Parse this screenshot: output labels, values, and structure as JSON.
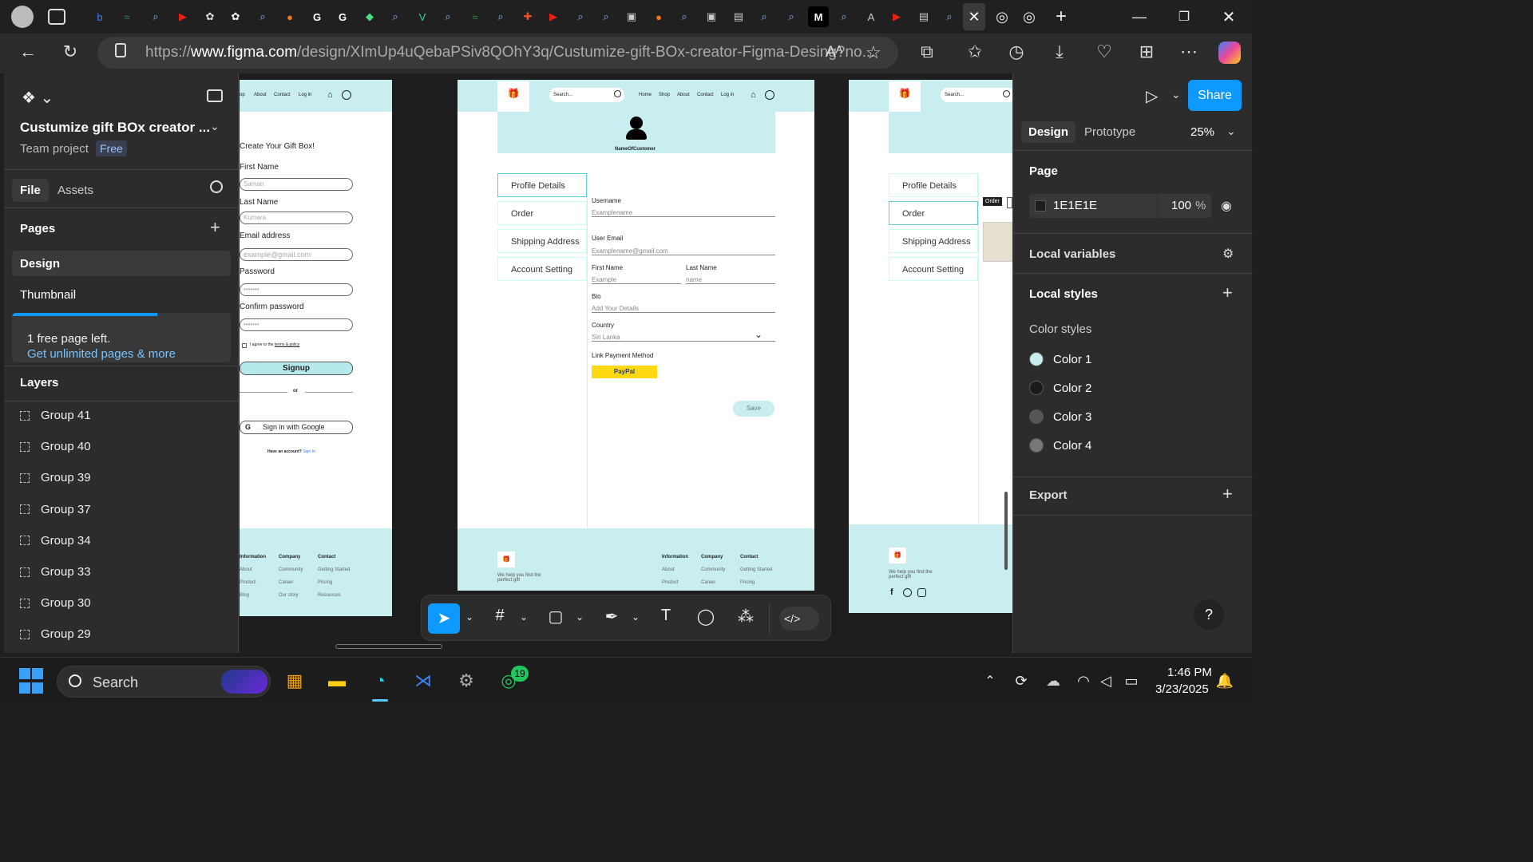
{
  "browser": {
    "url_prefix": "https://",
    "url_domain": "www.figma.com",
    "url_path": "/design/XImUp4uQebaPSiv8QOhY3q/Custumize-gift-BOx-creator-Figma-Desing?no...",
    "read_aloud": "Aᴬ"
  },
  "figma": {
    "file_title": "Custumize gift BOx creator ...",
    "project": "Team project",
    "plan_badge": "Free",
    "tabs": [
      "File",
      "Assets"
    ],
    "pages_header": "Pages",
    "pages": [
      "Design",
      "Thumbnail"
    ],
    "free_notice": "1 free page left.",
    "upgrade_link": "Get unlimited pages & more",
    "layers_header": "Layers",
    "layers": [
      "Group 41",
      "Group 40",
      "Group 39",
      "Group 37",
      "Group 34",
      "Group 33",
      "Group 30",
      "Group 29"
    ],
    "share": "Share",
    "right_tabs": [
      "Design",
      "Prototype"
    ],
    "zoom": "25%",
    "page_section": "Page",
    "page_color": "1E1E1E",
    "page_opacity": "100",
    "percent": "%",
    "local_variables": "Local variables",
    "local_styles": "Local styles",
    "color_styles": "Color styles",
    "colors": [
      {
        "name": "Color 1",
        "hex": "#c8eef0"
      },
      {
        "name": "Color 2",
        "hex": "#1a1a1a"
      },
      {
        "name": "Color 3",
        "hex": "#555555"
      },
      {
        "name": "Color 4",
        "hex": "#777777"
      }
    ],
    "export": "Export",
    "help": "?"
  },
  "signup": {
    "nav": [
      "op",
      "About",
      "Contact",
      "Log in"
    ],
    "title": "Create Your Gift Box!",
    "first_label": "First Name",
    "first_ph": "Saman",
    "last_label": "Last Name",
    "last_ph": "Kumara",
    "email_label": "Email address",
    "email_ph": "example@gmail.com",
    "pw_label": "Password",
    "pw_ph": "•••••••",
    "cpw_label": "Confirm password",
    "cpw_ph": "•••••••",
    "agree": "I agree to the",
    "terms": "terms & policy",
    "signup_btn": "Signup",
    "or": "or",
    "google_btn": "Sign in with Google",
    "have_account": "Have an account?",
    "signin": "Sign In",
    "footer_cols": [
      {
        "head": "Information",
        "items": [
          "About",
          "Product",
          "Blog"
        ]
      },
      {
        "head": "Company",
        "items": [
          "Community",
          "Career",
          "Our story"
        ]
      },
      {
        "head": "Contact",
        "items": [
          "Getting Started",
          "Pricing",
          "Resources"
        ]
      }
    ]
  },
  "profile": {
    "search_ph": "Search...",
    "nav": [
      "Home",
      "Shop",
      "About",
      "Contact",
      "Log in"
    ],
    "customer": "NameOfCustomer",
    "menu": [
      "Profile Details",
      "Order",
      "Shipping Address",
      "Account Setting"
    ],
    "username_label": "Username",
    "username_val": "Examplename",
    "email_label": "User Email",
    "email_val": "Examplename@gmail.com",
    "first_label": "First Name",
    "first_val": "Example",
    "last_label": "Last Name",
    "last_val": "name",
    "bio_label": "Bio",
    "bio_val": "Add Your Details",
    "country_label": "Country",
    "country_val": "Siri Lanka",
    "payment_label": "Link Payment Method",
    "paypal": "PayPal",
    "save": "Save",
    "footer_tagline": "We help you find the perfect gift",
    "footer_cols": [
      {
        "head": "Information",
        "items": [
          "About",
          "Product"
        ]
      },
      {
        "head": "Company",
        "items": [
          "Community",
          "Career"
        ]
      },
      {
        "head": "Contact",
        "items": [
          "Getting Started",
          "Pricing"
        ]
      }
    ]
  },
  "orders": {
    "search_ph": "Search...",
    "menu": [
      "Profile Details",
      "Order",
      "Shipping Address",
      "Account Setting"
    ],
    "order_tag": "Order",
    "footer_tagline": "We help you find the perfect gift"
  },
  "taskbar": {
    "search": "Search",
    "whatsapp_badge": "19",
    "time": "1:46 PM",
    "date": "3/23/2025"
  }
}
